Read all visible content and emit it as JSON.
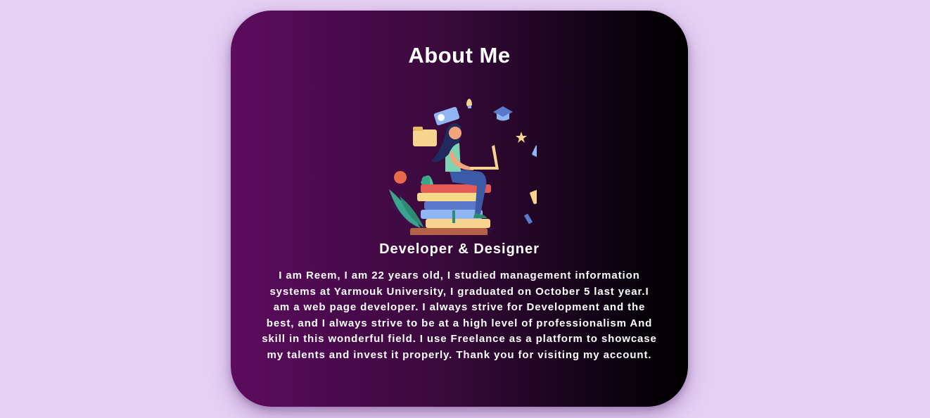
{
  "about": {
    "title": "About Me",
    "role": "Developer & Designer",
    "bio": "I am Reem, I am 22 years old, I studied management information systems at Yarmouk University, I graduated on October 5 last year.I am a web page developer. I always strive for Development and the best, and I always strive to be at a high level of professionalism And skill in this wonderful field. I use Freelance as a platform to showcase my talents and invest it properly. Thank you for visiting my account."
  },
  "illustration": {
    "icon": "woman-studying-laptop-on-books-illustration"
  },
  "colors": {
    "page_background": "#e6d0f4",
    "card_gradient_start": "#5c0b5e",
    "card_gradient_end": "#000000",
    "text": "#ffffff"
  }
}
